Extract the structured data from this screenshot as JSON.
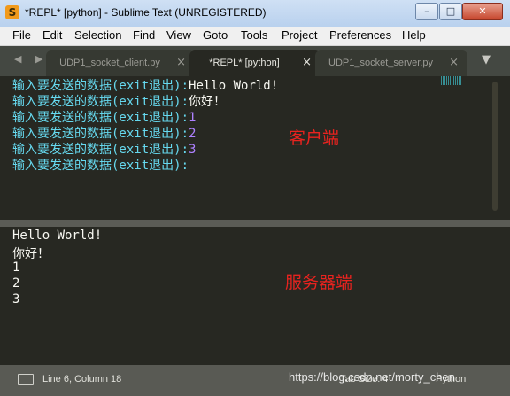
{
  "window": {
    "title": "*REPL* [python] - Sublime Text (UNREGISTERED)",
    "app_icon_glyph": "S",
    "minimize_glyph": "–",
    "maximize_glyph": "□",
    "close_glyph": "✕"
  },
  "menu": [
    "File",
    "Edit",
    "Selection",
    "Find",
    "View",
    "Goto",
    "Tools",
    "Project",
    "Preferences",
    "Help"
  ],
  "tabs": [
    {
      "label": "UDP1_socket_client.py",
      "close": "×"
    },
    {
      "label": "*REPL* [python]",
      "close": "×"
    },
    {
      "label": "UDP1_socket_server.py",
      "close": "×"
    }
  ],
  "tab_nav": "◀ ▶",
  "tab_dropdown": "▼",
  "editor": {
    "prompt": "输入要发送的数据(exit退出):",
    "lines": [
      {
        "value": "Hello World!"
      },
      {
        "value": "你好！"
      },
      {
        "value": "1"
      },
      {
        "value": "2"
      },
      {
        "value": "3"
      },
      {
        "value": ""
      }
    ],
    "label": "客户端"
  },
  "output": {
    "lines": [
      "Hello World!",
      "你好！",
      "1",
      "2",
      "3"
    ],
    "label": "服务器端"
  },
  "status": {
    "position": "Line 6, Column 18",
    "right1": "Tab Size: 4",
    "right2": "Python",
    "overlay": "https://blog.csdn.net/morty_chen"
  },
  "colors": {
    "editor_bg": "#272822",
    "prompt": "#66d9ef",
    "number": "#ae81ff",
    "annotation": "#e8231f"
  }
}
